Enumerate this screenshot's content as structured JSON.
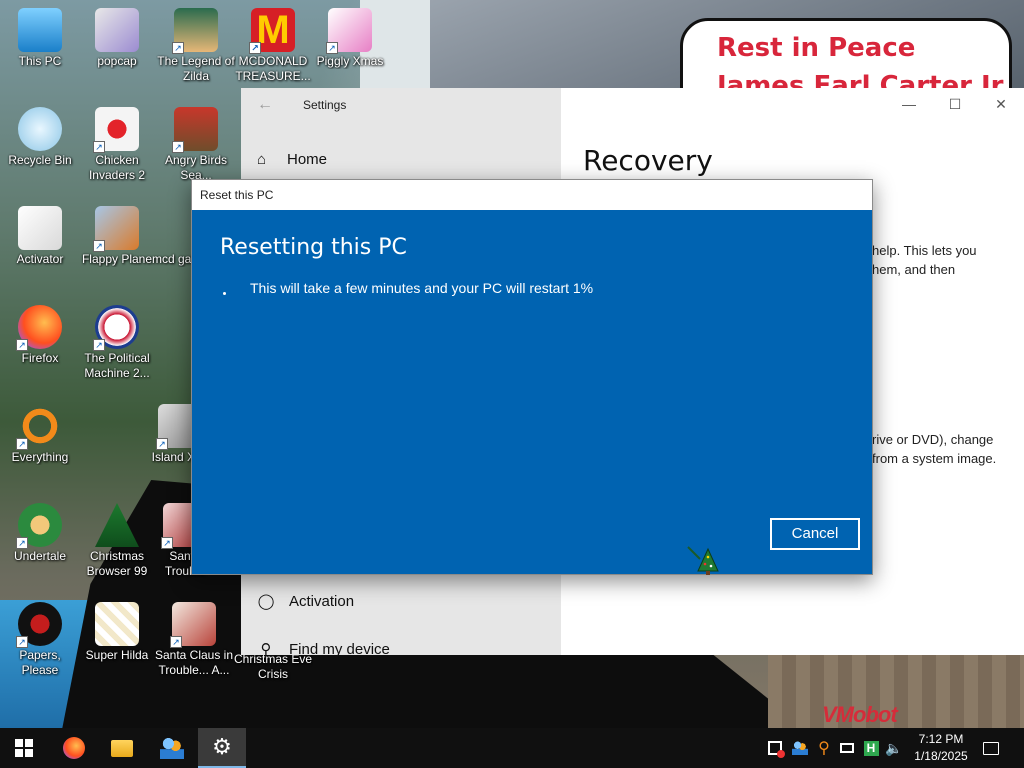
{
  "wallpaper": {
    "banner_line1": "Rest in Peace",
    "banner_line2": "James Earl Carter Jr.",
    "watermark": "VMobot"
  },
  "desktop_icons": [
    {
      "label": "This PC"
    },
    {
      "label": "popcap"
    },
    {
      "label": "The Legend of Zilda"
    },
    {
      "label": "MCDONALD TREASURE..."
    },
    {
      "label": "Piggly Xmas"
    },
    {
      "label": "Recycle Bin"
    },
    {
      "label": "Chicken Invaders 2"
    },
    {
      "label": "Angry Birds Sea..."
    },
    {
      "label": "Activator"
    },
    {
      "label": "Flappy Plane"
    },
    {
      "label": "mcd gal..."
    },
    {
      "label": "Firefox"
    },
    {
      "label": "The Political Machine 2..."
    },
    {
      "label": "Everything"
    },
    {
      "label": "Island Xr..."
    },
    {
      "label": "Undertale"
    },
    {
      "label": "Christmas Browser 99"
    },
    {
      "label": "Santa Trouble"
    },
    {
      "label": "Papers, Please"
    },
    {
      "label": "Super Hilda"
    },
    {
      "label": "Santa Claus in Trouble... A..."
    },
    {
      "label": "Christmas Eve Crisis"
    }
  ],
  "settings": {
    "app_title": "Settings",
    "home": "Home",
    "page_title": "Recovery",
    "nav": [
      {
        "label": "Activation"
      },
      {
        "label": "Find my device"
      }
    ],
    "para1_line1": "help. This lets you",
    "para1_line2": "hem, and then",
    "para2_line1": "rive or DVD), change",
    "para2_line2": "from a system image."
  },
  "dialog": {
    "title": "Reset this PC",
    "heading": "Resetting this PC",
    "message": "This will take a few minutes and your PC will restart 1%",
    "progress_percent": 1,
    "cancel_label": "Cancel"
  },
  "taskbar": {
    "time": "7:12 PM",
    "date": "1/18/2025",
    "apps": [
      "start-icon",
      "firefox-icon",
      "file-explorer-icon",
      "people-icon",
      "settings-icon"
    ]
  },
  "colors": {
    "dialog_blue": "#0063b1",
    "banner_red": "#d8263b"
  }
}
